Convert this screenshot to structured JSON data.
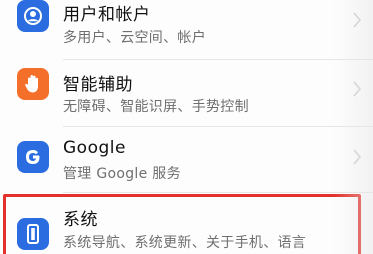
{
  "settings": {
    "items": [
      {
        "title": "用户和帐户",
        "subtitle": "多用户、云空间、帐户",
        "icon": "user-account-icon",
        "icon_color": "#2b6de0"
      },
      {
        "title": "智能辅助",
        "subtitle": "无障碍、智能识屏、手势控制",
        "icon": "hand-icon",
        "icon_color": "#f36f2a"
      },
      {
        "title": "Google",
        "subtitle": "管理 Google 服务",
        "icon": "google-g-icon",
        "icon_color": "#2b6de0"
      },
      {
        "title": "系统",
        "subtitle": "系统导航、系统更新、关于手机、语言",
        "icon": "phone-system-icon",
        "icon_color": "#2b6de0"
      }
    ],
    "highlight_color": "#e3312c"
  }
}
